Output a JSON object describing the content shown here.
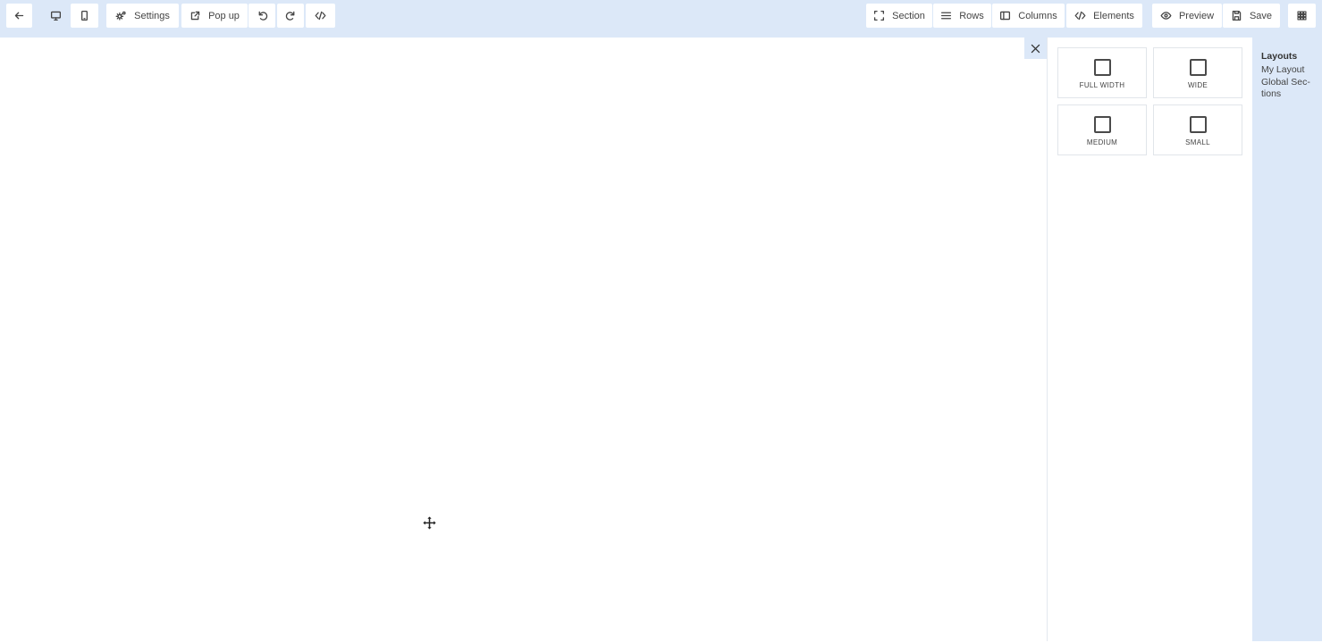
{
  "toolbar": {
    "settings_label": "Settings",
    "popup_label": "Pop up",
    "section_label": "Section",
    "rows_label": "Rows",
    "columns_label": "Columns",
    "elements_label": "Elements",
    "preview_label": "Preview",
    "save_label": "Save"
  },
  "panel": {
    "layouts": [
      {
        "label": "Full Width"
      },
      {
        "label": "Wide"
      },
      {
        "label": "Medium"
      },
      {
        "label": "Small"
      }
    ]
  },
  "side": {
    "heading": "Layouts",
    "items": [
      {
        "label": "My Layout"
      },
      {
        "label": "Global Sec- tions"
      }
    ]
  },
  "colors": {
    "toolbar_bg": "#dce8f8",
    "panel_bg": "#ffffff",
    "text": "#444444"
  }
}
